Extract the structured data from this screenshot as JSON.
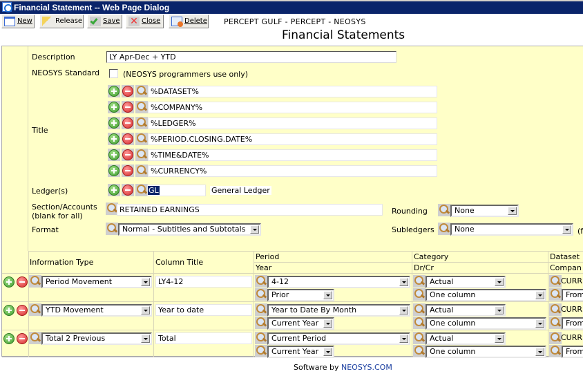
{
  "window": {
    "title": "Financial Statement -- Web Page Dialog"
  },
  "toolbar": {
    "buttons": [
      {
        "label": "New",
        "accel": "N",
        "icon": "new-window-icon"
      },
      {
        "label": "Release",
        "accel": "",
        "icon": "key-icon"
      },
      {
        "label": "Save",
        "accel": "S",
        "icon": "checkmark-icon"
      },
      {
        "label": "Close",
        "accel": "C",
        "icon": "red-x-icon"
      },
      {
        "label": "Delete",
        "accel": "D",
        "icon": "delete-record-icon"
      }
    ]
  },
  "header": {
    "company": "PERCEPT GULF - PERCEPT - NEOSYS",
    "page_title": "Financial Statements"
  },
  "form": {
    "description_label": "Description",
    "description_value": "LY Apr-Dec + YTD",
    "neosys_standard_label": "NEOSYS Standard",
    "neosys_standard_checked": false,
    "neosys_standard_note": "(NEOSYS programmers use only)",
    "title_label": "Title",
    "title_lines": [
      "%DATASET%",
      "%COMPANY%",
      "%LEDGER%",
      "%PERIOD.CLOSING.DATE%",
      "%TIME&DATE%",
      "%CURRENCY%"
    ],
    "ledgers_label": "Ledger(s)",
    "ledger_code": "GL",
    "ledger_name": "General Ledger",
    "section_label_1": "Section/Accounts",
    "section_label_2": "(blank for all)",
    "section_value": "RETAINED EARNINGS",
    "rounding_label": "Rounding",
    "rounding_value": "None",
    "format_label": "Format",
    "format_value": "Normal - Subtitles and Subtotals",
    "subledgers_label": "Subledgers",
    "subledgers_value": "None",
    "subledgers_note": "(f"
  },
  "columns_table": {
    "headers": {
      "information_type": "Information Type",
      "column_title": "Column Title",
      "period": "Period",
      "year": "Year",
      "category": "Category",
      "drcr": "Dr/Cr",
      "dataset": "Dataset",
      "company": "Compan"
    },
    "rows": [
      {
        "info_type": "Period Movement",
        "column_title": "LY4-12",
        "period": "4-12",
        "year": "Prior",
        "category": "Actual",
        "drcr": "One column",
        "dataset": "CURR",
        "company": "From"
      },
      {
        "info_type": "YTD Movement",
        "column_title": "Year to date",
        "period": "Year to Date By Month",
        "year": "Current Year",
        "category": "Actual",
        "drcr": "One column",
        "dataset": "CURR",
        "company": "From"
      },
      {
        "info_type": "Total 2 Previous",
        "column_title": "Total",
        "period": "Current Period",
        "year": "Current Year",
        "category": "Actual",
        "drcr": "One column",
        "dataset": "CURR",
        "company": "From"
      }
    ]
  },
  "footer": {
    "prefix": "Software by",
    "link": "NEOSYS.COM"
  },
  "colors": {
    "panel_bg": "#ffffc8",
    "titlebar_bg": "#0a246a",
    "link": "#1a3ea0"
  }
}
